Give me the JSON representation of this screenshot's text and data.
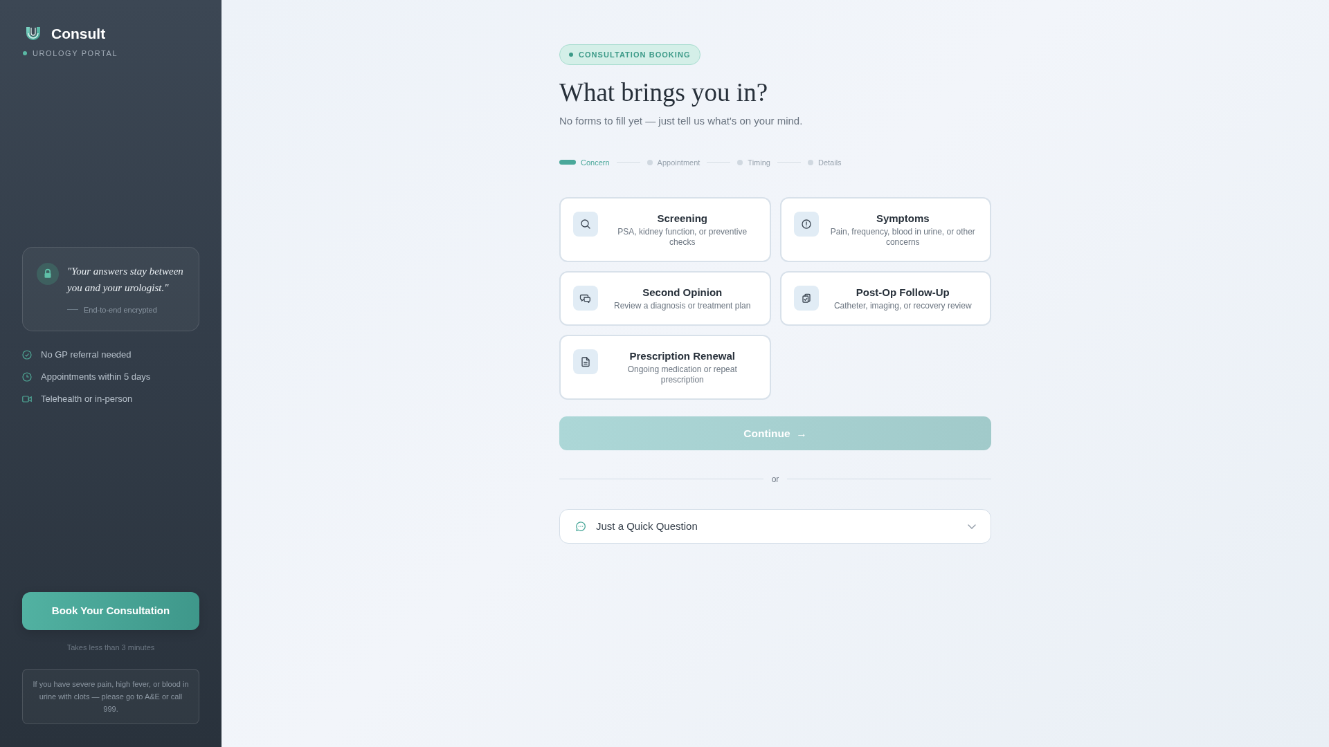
{
  "sidebar": {
    "brand": {
      "name": "Consult",
      "subtitle": "UROLOGY PORTAL"
    },
    "quote": {
      "text": "\"Your answers stay between you and your urologist.\"",
      "caption": "End-to-end encrypted"
    },
    "features": [
      {
        "kind": "check",
        "label": "No GP referral needed"
      },
      {
        "kind": "clock",
        "label": "Appointments within 5 days"
      },
      {
        "kind": "video",
        "label": "Telehealth or in-person"
      }
    ],
    "cta": {
      "label": "Book Your Consultation",
      "note": "Takes less than 3 minutes"
    },
    "warning": "If you have severe pain, high fever, or blood in urine with clots — please go to A&E or call 999."
  },
  "main": {
    "badge": "CONSULTATION BOOKING",
    "title": "What brings you in?",
    "subtitle": "No forms to fill yet — just tell us what's on your mind.",
    "steps": [
      {
        "label": "Concern",
        "current": true
      },
      {
        "label": "Appointment",
        "current": false
      },
      {
        "label": "Timing",
        "current": false
      },
      {
        "label": "Details",
        "current": false
      }
    ],
    "options": [
      {
        "kind": "search",
        "title": "Screening",
        "description": "PSA, kidney function, or preventive checks",
        "selected": false
      },
      {
        "kind": "alert",
        "title": "Symptoms",
        "description": "Pain, frequency, blood in urine, or other concerns",
        "selected": false
      },
      {
        "kind": "chat",
        "title": "Second Opinion",
        "description": "Review a diagnosis or treatment plan",
        "selected": false
      },
      {
        "kind": "clipboard",
        "title": "Post-Op Follow-Up",
        "description": "Catheter, imaging, or recovery review",
        "selected": false
      },
      {
        "kind": "document",
        "title": "Prescription Renewal",
        "description": "Ongoing medication or repeat prescription",
        "selected": false
      }
    ],
    "continue": {
      "label": "Continue",
      "arrow": "→",
      "disabled": true
    },
    "divider": "or",
    "quick_question": {
      "label": "Just a Quick Question",
      "expanded": false
    }
  }
}
